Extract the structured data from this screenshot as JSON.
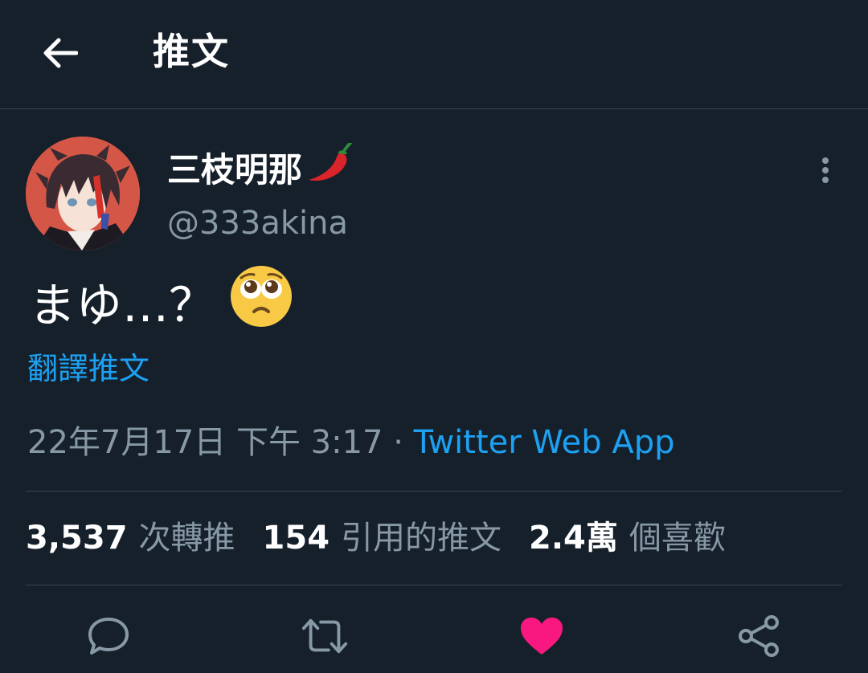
{
  "header": {
    "title": "推文",
    "back_icon": "arrow-left-icon"
  },
  "author": {
    "display_name": "三枝明那",
    "name_emoji": "chili-pepper-icon",
    "handle": "@333akina"
  },
  "tweet": {
    "text": "まゆ…？",
    "emoji": "pleading-face-icon",
    "translate_label": "翻譯推文",
    "timestamp": "22年7月17日 下午 3:17",
    "separator": " · ",
    "source": "Twitter Web App"
  },
  "stats": {
    "retweets_count": "3,537",
    "retweets_label": "次轉推",
    "quotes_count": "154",
    "quotes_label": "引用的推文",
    "likes_count": "2.4萬",
    "likes_label": "個喜歡"
  },
  "actions": [
    {
      "name": "reply",
      "icon": "comment-icon"
    },
    {
      "name": "retweet",
      "icon": "retweet-icon"
    },
    {
      "name": "like",
      "icon": "heart-icon"
    },
    {
      "name": "share",
      "icon": "share-icon"
    }
  ],
  "colors": {
    "background": "#15202b",
    "divider": "#38444d",
    "secondary_text": "#8899a6",
    "accent_blue": "#1da1f2",
    "like_pink": "#f91880"
  }
}
